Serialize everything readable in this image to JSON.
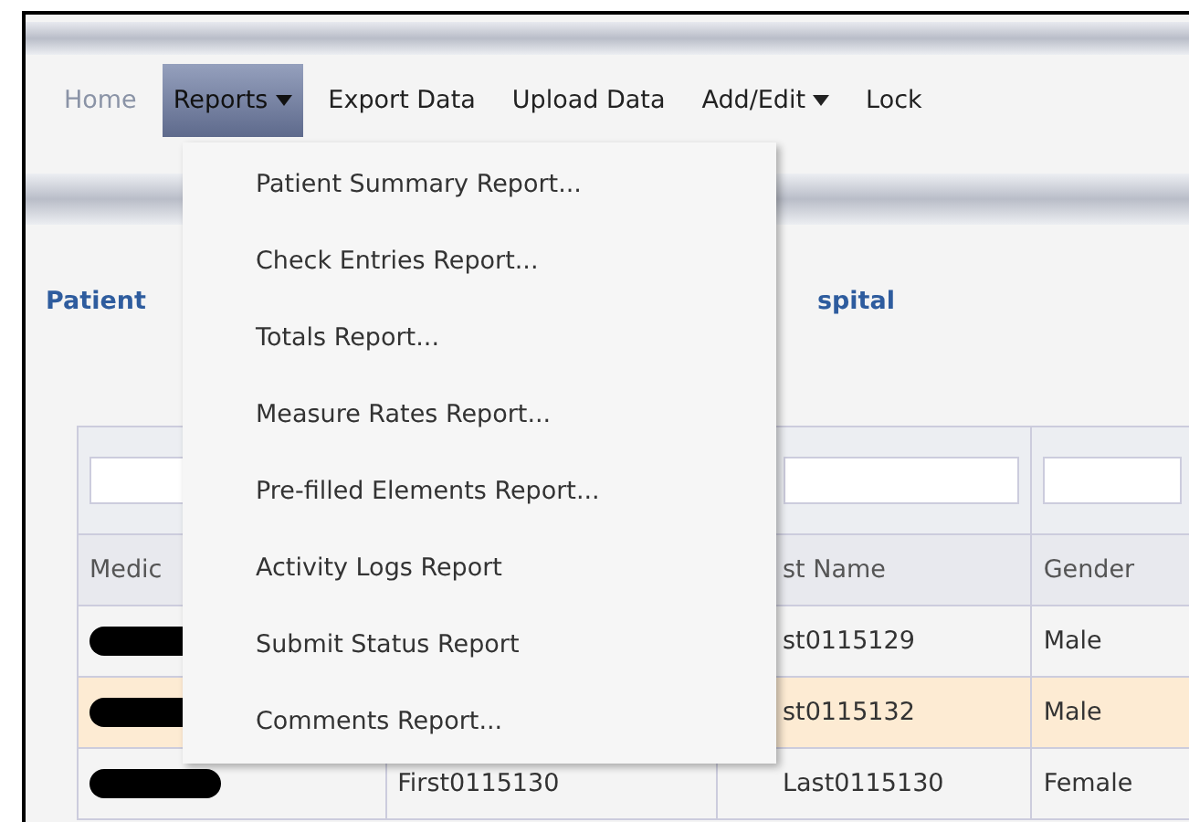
{
  "nav": [
    {
      "label": "Home",
      "selected": false,
      "disabled": true,
      "has_menu": false
    },
    {
      "label": "Reports",
      "selected": true,
      "disabled": false,
      "has_menu": true
    },
    {
      "label": "Export Data",
      "selected": false,
      "disabled": false,
      "has_menu": false
    },
    {
      "label": "Upload Data",
      "selected": false,
      "disabled": false,
      "has_menu": false
    },
    {
      "label": "Add/Edit",
      "selected": false,
      "disabled": false,
      "has_menu": true
    },
    {
      "label": "Lock",
      "selected": false,
      "disabled": false,
      "has_menu": false
    }
  ],
  "menu": {
    "items": [
      "Patient Summary Report...",
      "Check Entries Report...",
      "Totals Report...",
      "Measure Rates Report...",
      "Pre-filled Elements Report...",
      "Activity Logs Report",
      "Submit Status Report",
      "Comments Report..."
    ]
  },
  "heading": {
    "left": "Patient",
    "right": "spital"
  },
  "table": {
    "columns": [
      "Medic",
      "",
      "st Name",
      "Gender"
    ],
    "rows": [
      {
        "redacted": true,
        "cells": [
          "",
          "",
          "st0115129",
          "Male"
        ],
        "selected": false
      },
      {
        "redacted": true,
        "cells": [
          "",
          "",
          "st0115132",
          "Male"
        ],
        "selected": true
      },
      {
        "redacted": true,
        "cells": [
          "",
          "First0115130",
          "Last0115130",
          "Female"
        ],
        "selected": false
      }
    ]
  }
}
